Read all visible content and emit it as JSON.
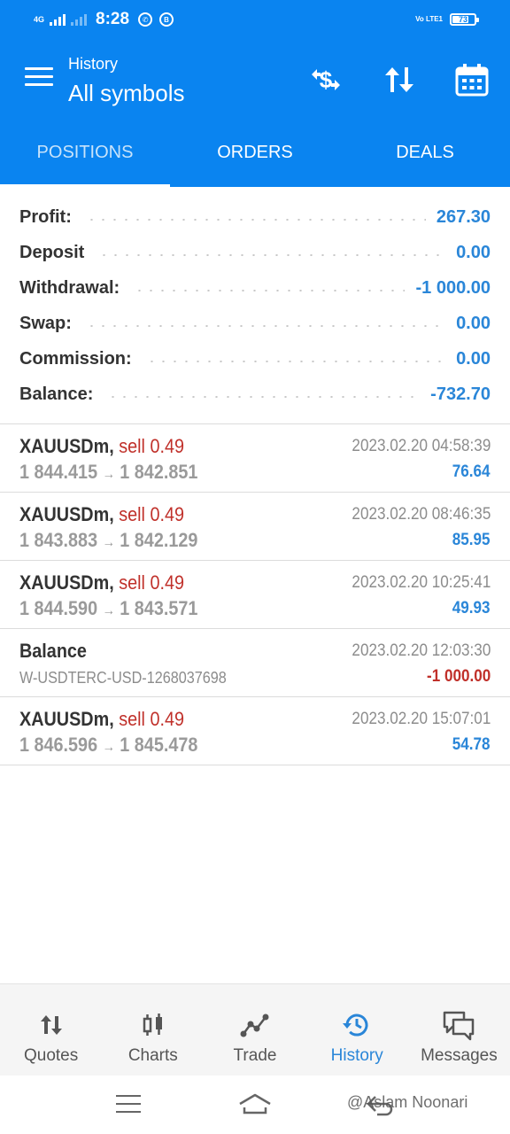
{
  "status_bar": {
    "network": "4G",
    "time": "8:28",
    "volte": "Vo LTE1",
    "battery": "73"
  },
  "header": {
    "subtitle": "History",
    "title": "All symbols",
    "icons": [
      "menu-icon",
      "currency-exchange-icon",
      "sort-icon",
      "calendar-icon"
    ]
  },
  "tabs": [
    {
      "label": "POSITIONS",
      "active": true
    },
    {
      "label": "ORDERS",
      "active": false
    },
    {
      "label": "DEALS",
      "active": false
    }
  ],
  "summary": [
    {
      "label": "Profit:",
      "value": "267.30"
    },
    {
      "label": "Deposit",
      "value": "0.00"
    },
    {
      "label": "Withdrawal:",
      "value": "-1 000.00"
    },
    {
      "label": "Swap:",
      "value": "0.00"
    },
    {
      "label": "Commission:",
      "value": "0.00"
    },
    {
      "label": "Balance:",
      "value": "-732.70"
    }
  ],
  "deals": [
    {
      "symbol": "XAUUSDm,",
      "type": "sell 0.49",
      "time": "2023.02.20 04:58:39",
      "open_price": "1 844.415",
      "arrow": "→",
      "close_price": "1 842.851",
      "profit": "76.64"
    },
    {
      "symbol": "XAUUSDm,",
      "type": "sell 0.49",
      "time": "2023.02.20 08:46:35",
      "open_price": "1 843.883",
      "arrow": "→",
      "close_price": "1 842.129",
      "profit": "85.95"
    },
    {
      "symbol": "XAUUSDm,",
      "type": "sell 0.49",
      "time": "2023.02.20 10:25:41",
      "open_price": "1 844.590",
      "arrow": "→",
      "close_price": "1 843.571",
      "profit": "49.93"
    },
    {
      "symbol": "Balance",
      "time": "2023.02.20 12:03:30",
      "comment": "W-USDTERC-USD-1268037698",
      "profit": "-1 000.00"
    },
    {
      "symbol": "XAUUSDm,",
      "type": "sell 0.49",
      "time": "2023.02.20 15:07:01",
      "open_price": "1 846.596",
      "arrow": "→",
      "close_price": "1 845.478",
      "profit": "54.78"
    }
  ],
  "bottom_nav": [
    {
      "label": "Quotes",
      "icon": "quotes-icon",
      "active": false
    },
    {
      "label": "Charts",
      "icon": "charts-icon",
      "active": false
    },
    {
      "label": "Trade",
      "icon": "trade-icon",
      "active": false
    },
    {
      "label": "History",
      "icon": "history-icon",
      "active": true
    },
    {
      "label": "Messages",
      "icon": "messages-icon",
      "active": false
    }
  ],
  "watermark": "@Aslam Noonari",
  "colors": {
    "primary": "#0a84f0",
    "positive": "#2a86d8",
    "sell": "#c0302a"
  }
}
